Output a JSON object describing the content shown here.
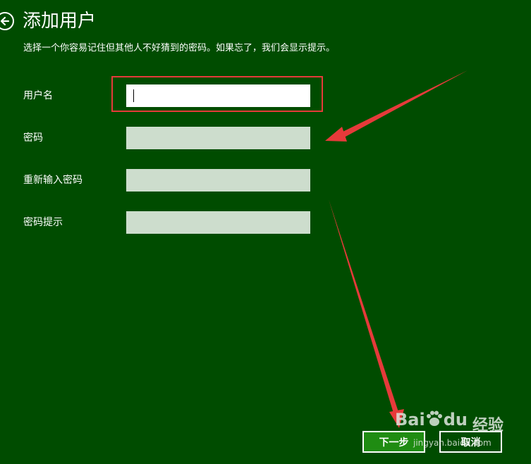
{
  "header": {
    "title": "添加用户",
    "subtitle": "选择一个你容易记住但其他人不好猜到的密码。如果忘了，我们会显示提示。"
  },
  "form": {
    "fields": [
      {
        "label": "用户名",
        "value": ""
      },
      {
        "label": "密码",
        "value": ""
      },
      {
        "label": "重新输入密码",
        "value": ""
      },
      {
        "label": "密码提示",
        "value": ""
      }
    ]
  },
  "buttons": {
    "next_label": "下一步",
    "cancel_label": "取消"
  },
  "watermark": {
    "brand": "Bai",
    "brand_suffix": "du",
    "cn": "经验",
    "url": "jingyan.baidu.com"
  },
  "colors": {
    "background": "#004c00",
    "annotation": "#e63a3a",
    "next_button": "#1f8c12",
    "input_disabled": "#cdddcd"
  },
  "icons": {
    "back": "back-arrow-icon"
  }
}
